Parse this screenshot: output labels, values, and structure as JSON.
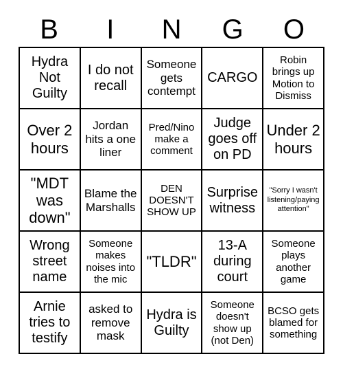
{
  "card": {
    "headers": [
      "B",
      "I",
      "N",
      "G",
      "O"
    ],
    "rows": [
      [
        {
          "text": "Hydra Not Guilty",
          "size": "lg"
        },
        {
          "text": "I do not recall",
          "size": "lg"
        },
        {
          "text": "Someone gets contempt",
          "size": "md"
        },
        {
          "text": "CARGO",
          "size": "lg"
        },
        {
          "text": "Robin brings up Motion to Dismiss",
          "size": "sm"
        }
      ],
      [
        {
          "text": "Over 2 hours",
          "size": "xl"
        },
        {
          "text": "Jordan hits a one liner",
          "size": "md"
        },
        {
          "text": "Pred/Nino make a comment",
          "size": "sm"
        },
        {
          "text": "Judge goes off on PD",
          "size": "lg"
        },
        {
          "text": "Under 2 hours",
          "size": "xl"
        }
      ],
      [
        {
          "text": "\"MDT was down\"",
          "size": "xl"
        },
        {
          "text": "Blame the Marshalls",
          "size": "md"
        },
        {
          "text": "DEN DOESN'T SHOW UP",
          "size": "sm"
        },
        {
          "text": "Surprise witness",
          "size": "lg"
        },
        {
          "text": "\"Sorry I wasn't listening/paying attention\"",
          "size": "xs"
        }
      ],
      [
        {
          "text": "Wrong street name",
          "size": "lg"
        },
        {
          "text": "Someone makes noises into the mic",
          "size": "sm"
        },
        {
          "text": "\"TLDR\"",
          "size": "xl"
        },
        {
          "text": "13-A during court",
          "size": "lg"
        },
        {
          "text": "Someone plays another game",
          "size": "sm"
        }
      ],
      [
        {
          "text": "Arnie tries to testify",
          "size": "lg"
        },
        {
          "text": "asked to remove mask",
          "size": "md"
        },
        {
          "text": "Hydra is Guilty",
          "size": "lg"
        },
        {
          "text": "Someone doesn't show up (not Den)",
          "size": "sm"
        },
        {
          "text": "BCSO gets blamed for something",
          "size": "sm"
        }
      ]
    ]
  },
  "colors": {
    "border": "#000000",
    "text": "#000000",
    "background": "#ffffff"
  }
}
